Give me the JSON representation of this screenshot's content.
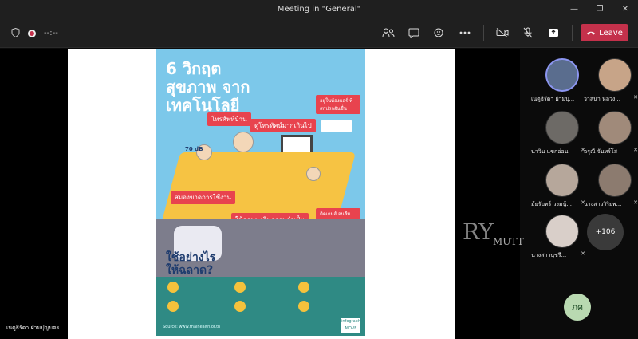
{
  "window": {
    "title": "Meeting in \"General\"",
    "controls": [
      "—",
      "❐",
      "✕"
    ]
  },
  "toolbar": {
    "timer": "--:--",
    "icons": [
      "people-icon",
      "chat-icon",
      "reactions-icon",
      "more-icon",
      "camera-off-icon",
      "mic-off-icon",
      "share-icon"
    ],
    "leave_label": "Leave",
    "leave_color": "#c4314b"
  },
  "poster": {
    "title": "6 วิกฤตสุขภาพ จากเทคโนโลยี",
    "labels": [
      "โทรศัพท์บ้าน",
      "ดูโทรทัศน์มากเกินไป",
      "อยู่ในห้องแอร์ ที่สกปรกอันชื่น",
      "สมองขาดการใช้งาน",
      "ใช้คอมฯ เกินความจำเป็น",
      "ติดเกมส์ จนลืมเวลา"
    ],
    "question": "ใช้อย่างไร ให้ฉลาด?",
    "decibel": "70 dB",
    "brand": "infographic MOVE",
    "source": "Source: www.thaihealth.or.th"
  },
  "footer": {
    "presenter": "เนตูธิรัดา ฝ่ามปุญบตร"
  },
  "participants": [
    {
      "name": "เนตูธิรัดา ฝ่ามปุ...",
      "active": true
    },
    {
      "name": "วาสนา หลวง...",
      "active": false
    },
    {
      "name": "นาวิน แขกอ่อน",
      "active": false
    },
    {
      "name": "อรุณี จันทร์โส",
      "active": false
    },
    {
      "name": "มุ้ยรับทร์ วงมนู้...",
      "active": false
    },
    {
      "name": "นางสาววิริยพ...",
      "active": false
    },
    {
      "name": "นางสาวนุชรี...",
      "active": false
    }
  ],
  "more_count": "+106",
  "self_initials": "ภศ",
  "watermark": {
    "big": "RY",
    "small": "MUTT"
  }
}
